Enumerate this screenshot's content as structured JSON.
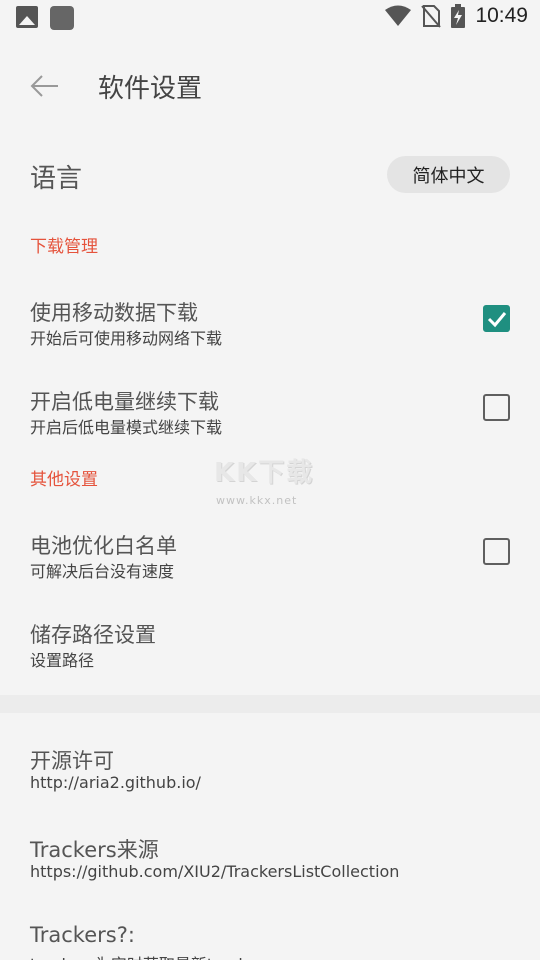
{
  "status_bar": {
    "time": "10:49",
    "icons": [
      "gallery-icon",
      "app-square-icon",
      "wifi-icon",
      "no-sim-icon",
      "battery-charging-icon"
    ]
  },
  "header": {
    "title": "软件设置",
    "back_icon": "arrow-left-icon"
  },
  "language": {
    "label": "语言",
    "value": "简体中文"
  },
  "sections": {
    "download": "下载管理",
    "other": "其他设置"
  },
  "settings": {
    "mobile_data": {
      "title": "使用移动数据下载",
      "sub": "开始后可使用移动网络下载",
      "checked": true
    },
    "low_battery": {
      "title": "开启低电量继续下载",
      "sub": "开启后低电量模式继续下载",
      "checked": false
    },
    "battery_whitelist": {
      "title": "电池优化白名单",
      "sub": "可解决后台没有速度",
      "checked": false
    },
    "storage_path": {
      "title": "储存路径设置",
      "sub": "设置路径"
    },
    "open_source": {
      "title": "开源许可",
      "sub": "http://aria2.github.io/"
    },
    "trackers_source": {
      "title": "Trackers来源",
      "sub": "https://github.com/XIU2/TrackersListCollection"
    },
    "trackers_info": {
      "title": "Trackers?:",
      "sub": "trackers为实时获取最新trackers"
    }
  },
  "watermark": {
    "big": "KK下载",
    "small": "www.kkx.net"
  },
  "colors": {
    "accent": "#1f8f80",
    "section": "#e5533c",
    "background": "#f4f4f4"
  }
}
